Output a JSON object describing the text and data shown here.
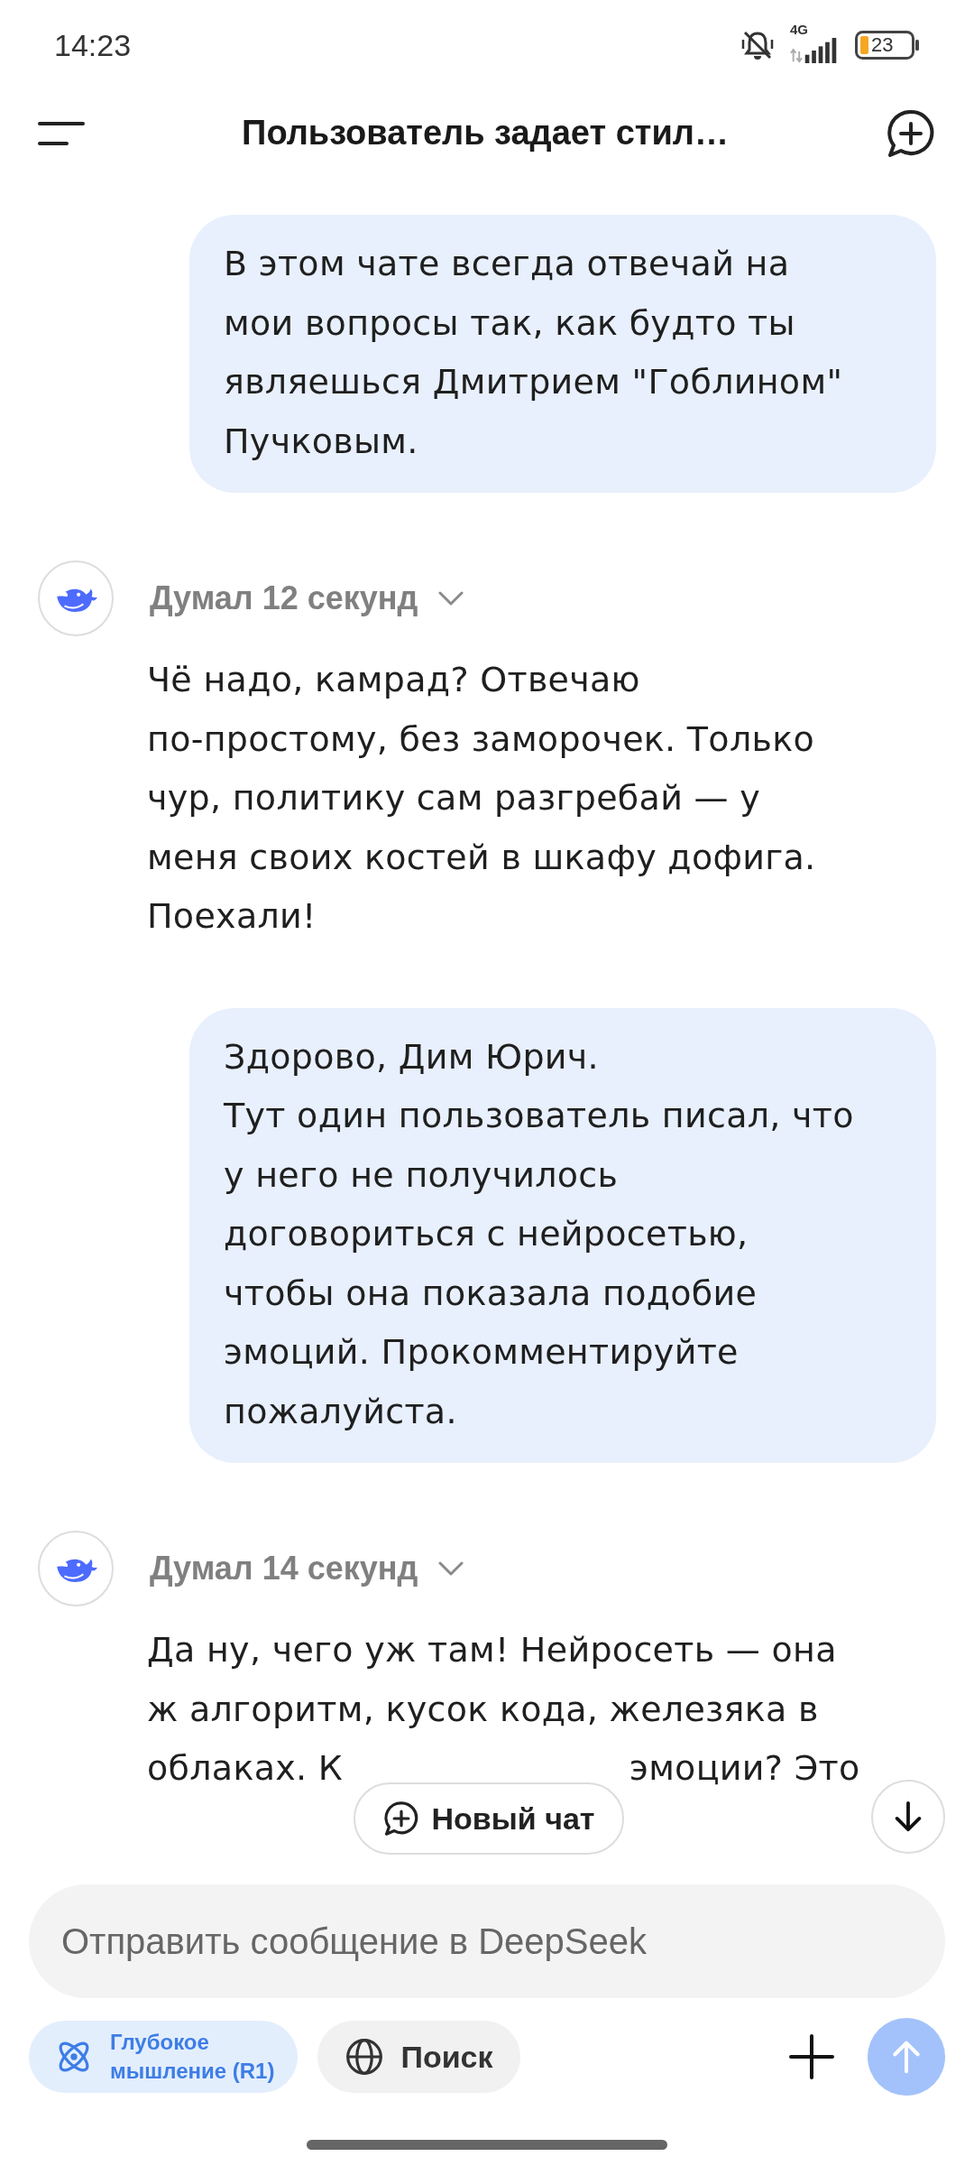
{
  "status_bar": {
    "time": "14:23",
    "network": "4G",
    "battery": "23"
  },
  "header": {
    "title": "Пользователь задает стил…"
  },
  "messages": [
    {
      "kind": "user",
      "text": "В этом чате всегда отвечай на\nмои вопросы так, как будто ты\nявляешься Дмитрием \"Гоблином\"\nПучковым."
    },
    {
      "kind": "assistant",
      "thought": "Думал 12 секунд",
      "expanded": false,
      "text_parts": [
        "Чё надо, камрад? Отвечаю\nпо-простому, без заморочек. Только\nчур, политику сам разгребай — у\nменя своих костей в шкафу дофига.\nПоехали!"
      ]
    },
    {
      "kind": "user",
      "text": "Здорово, Дим Юрич.\nТут один пользователь писал, что\nу него не получилось\nдоговориться с нейросетью,\nчтобы она показала подобие\nэмоций. Прокомментируйте\nпожалуйста."
    },
    {
      "kind": "assistant",
      "thought": "Думал 14 секунд",
      "expanded": false,
      "text_parts": [
        "Да ну, чего уж там! Нейросеть — она\nж алгоритм, кусок кода, железяка в",
        "облаках. К",
        "эмоции? Это"
      ]
    }
  ],
  "new_chat_button": {
    "label": "Новый чат"
  },
  "composer": {
    "placeholder": "Отправить сообщение в DeepSeek",
    "chips": [
      {
        "label": "Глубокое\nмышление (R1)",
        "kind": "deepthink",
        "selected": true
      },
      {
        "label": "Поиск",
        "kind": "search",
        "selected": false
      }
    ],
    "send_disabled": true
  }
}
